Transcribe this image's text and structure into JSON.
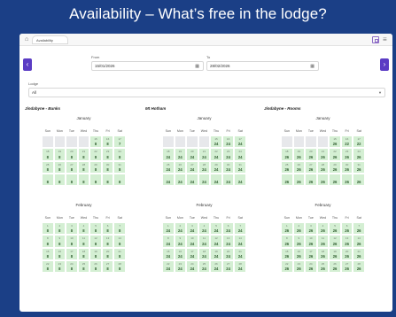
{
  "banner": {
    "title": "Availability – What’s free in the lodge?"
  },
  "topbar": {
    "home_icon": "home-icon",
    "tab_label": "Availability"
  },
  "filters": {
    "from_label": "From",
    "from_value": "15/01/2026",
    "to_label": "To",
    "to_value": "28/02/2026",
    "lodge_label": "Lodge",
    "lodge_value": "All"
  },
  "weekdays": [
    "Sun",
    "Mon",
    "Tue",
    "Wed",
    "Thu",
    "Fri",
    "Sat"
  ],
  "lodges": [
    {
      "name": "Jindabyne - Bunks",
      "months": [
        {
          "name": "January",
          "weeks": [
            [
              null,
              null,
              null,
              null,
              [
                "15",
                "8"
              ],
              [
                "16",
                "8"
              ],
              [
                "17",
                "7"
              ]
            ],
            [
              [
                "18",
                "8"
              ],
              [
                "19",
                "8"
              ],
              [
                "20",
                "8"
              ],
              [
                "21",
                "8"
              ],
              [
                "22",
                "8"
              ],
              [
                "23",
                "8"
              ],
              [
                "24",
                "8"
              ]
            ],
            [
              [
                "25",
                "8"
              ],
              [
                "26",
                "8"
              ],
              [
                "27",
                "8"
              ],
              [
                "28",
                "8"
              ],
              [
                "29",
                "8"
              ],
              [
                "30",
                "8"
              ],
              [
                "31",
                "8"
              ]
            ],
            [
              [
                "",
                "8"
              ],
              [
                "",
                "8"
              ],
              [
                "",
                "8"
              ],
              [
                "",
                "8"
              ],
              [
                "",
                "8"
              ],
              [
                "",
                "8"
              ],
              [
                "",
                "8"
              ]
            ]
          ]
        },
        {
          "name": "February",
          "weeks": [
            [
              [
                "1",
                "8"
              ],
              [
                "2",
                "8"
              ],
              [
                "3",
                "8"
              ],
              [
                "4",
                "8"
              ],
              [
                "5",
                "8"
              ],
              [
                "6",
                "8"
              ],
              [
                "7",
                "8"
              ]
            ],
            [
              [
                "8",
                "8"
              ],
              [
                "9",
                "8"
              ],
              [
                "10",
                "8"
              ],
              [
                "11",
                "8"
              ],
              [
                "12",
                "8"
              ],
              [
                "13",
                "8"
              ],
              [
                "14",
                "8"
              ]
            ],
            [
              [
                "15",
                "8"
              ],
              [
                "16",
                "8"
              ],
              [
                "17",
                "8"
              ],
              [
                "18",
                "8"
              ],
              [
                "19",
                "8"
              ],
              [
                "20",
                "8"
              ],
              [
                "21",
                "8"
              ]
            ],
            [
              [
                "22",
                "8"
              ],
              [
                "23",
                "8"
              ],
              [
                "24",
                "8"
              ],
              [
                "25",
                "8"
              ],
              [
                "26",
                "8"
              ],
              [
                "27",
                "8"
              ],
              [
                "28",
                "8"
              ]
            ]
          ]
        }
      ]
    },
    {
      "name": "Mt Hotham",
      "months": [
        {
          "name": "January",
          "weeks": [
            [
              null,
              null,
              null,
              null,
              [
                "15",
                "24"
              ],
              [
                "16",
                "24"
              ],
              [
                "17",
                "24"
              ]
            ],
            [
              [
                "18",
                "24"
              ],
              [
                "19",
                "24"
              ],
              [
                "20",
                "24"
              ],
              [
                "21",
                "24"
              ],
              [
                "22",
                "24"
              ],
              [
                "23",
                "24"
              ],
              [
                "24",
                "24"
              ]
            ],
            [
              [
                "25",
                "24"
              ],
              [
                "26",
                "24"
              ],
              [
                "27",
                "24"
              ],
              [
                "28",
                "24"
              ],
              [
                "29",
                "24"
              ],
              [
                "30",
                "24"
              ],
              [
                "31",
                "24"
              ]
            ],
            [
              [
                "",
                "24"
              ],
              [
                "",
                "24"
              ],
              [
                "",
                "24"
              ],
              [
                "",
                "24"
              ],
              [
                "",
                "24"
              ],
              [
                "",
                "24"
              ],
              [
                "",
                "24"
              ]
            ]
          ]
        },
        {
          "name": "February",
          "weeks": [
            [
              [
                "1",
                "24"
              ],
              [
                "2",
                "24"
              ],
              [
                "3",
                "24"
              ],
              [
                "4",
                "24"
              ],
              [
                "5",
                "24"
              ],
              [
                "6",
                "24"
              ],
              [
                "7",
                "24"
              ]
            ],
            [
              [
                "8",
                "24"
              ],
              [
                "9",
                "24"
              ],
              [
                "10",
                "24"
              ],
              [
                "11",
                "24"
              ],
              [
                "12",
                "24"
              ],
              [
                "13",
                "24"
              ],
              [
                "14",
                "24"
              ]
            ],
            [
              [
                "15",
                "24"
              ],
              [
                "16",
                "24"
              ],
              [
                "17",
                "24"
              ],
              [
                "18",
                "24"
              ],
              [
                "19",
                "24"
              ],
              [
                "20",
                "24"
              ],
              [
                "21",
                "24"
              ]
            ],
            [
              [
                "22",
                "24"
              ],
              [
                "23",
                "24"
              ],
              [
                "24",
                "24"
              ],
              [
                "25",
                "24"
              ],
              [
                "26",
                "24"
              ],
              [
                "27",
                "24"
              ],
              [
                "28",
                "24"
              ]
            ]
          ]
        }
      ]
    },
    {
      "name": "Jindabyne - Rooms",
      "months": [
        {
          "name": "January",
          "weeks": [
            [
              null,
              null,
              null,
              null,
              [
                "15",
                "26"
              ],
              [
                "16",
                "22"
              ],
              [
                "17",
                "22"
              ]
            ],
            [
              [
                "18",
                "26"
              ],
              [
                "19",
                "26"
              ],
              [
                "20",
                "26"
              ],
              [
                "21",
                "26"
              ],
              [
                "22",
                "26"
              ],
              [
                "23",
                "26"
              ],
              [
                "24",
                "26"
              ]
            ],
            [
              [
                "25",
                "26"
              ],
              [
                "26",
                "26"
              ],
              [
                "27",
                "26"
              ],
              [
                "28",
                "26"
              ],
              [
                "29",
                "26"
              ],
              [
                "30",
                "26"
              ],
              [
                "31",
                "26"
              ]
            ],
            [
              [
                "",
                "26"
              ],
              [
                "",
                "26"
              ],
              [
                "",
                "26"
              ],
              [
                "",
                "26"
              ],
              [
                "",
                "26"
              ],
              [
                "",
                "26"
              ],
              [
                "",
                "26"
              ]
            ]
          ]
        },
        {
          "name": "February",
          "weeks": [
            [
              [
                "1",
                "26"
              ],
              [
                "2",
                "26"
              ],
              [
                "3",
                "26"
              ],
              [
                "4",
                "26"
              ],
              [
                "5",
                "26"
              ],
              [
                "6",
                "26"
              ],
              [
                "7",
                "26"
              ]
            ],
            [
              [
                "8",
                "26"
              ],
              [
                "9",
                "26"
              ],
              [
                "10",
                "26"
              ],
              [
                "11",
                "26"
              ],
              [
                "12",
                "26"
              ],
              [
                "13",
                "26"
              ],
              [
                "14",
                "26"
              ]
            ],
            [
              [
                "15",
                "26"
              ],
              [
                "16",
                "26"
              ],
              [
                "17",
                "26"
              ],
              [
                "18",
                "26"
              ],
              [
                "19",
                "26"
              ],
              [
                "20",
                "26"
              ],
              [
                "21",
                "26"
              ]
            ],
            [
              [
                "22",
                "26"
              ],
              [
                "23",
                "26"
              ],
              [
                "24",
                "26"
              ],
              [
                "25",
                "26"
              ],
              [
                "26",
                "26"
              ],
              [
                "27",
                "26"
              ],
              [
                "28",
                "26"
              ]
            ]
          ]
        }
      ]
    }
  ],
  "colors": {
    "available": "#d4efd3",
    "empty": "#e7e8eb",
    "accent": "#5b3cc4",
    "banner": "#1b3f86"
  }
}
